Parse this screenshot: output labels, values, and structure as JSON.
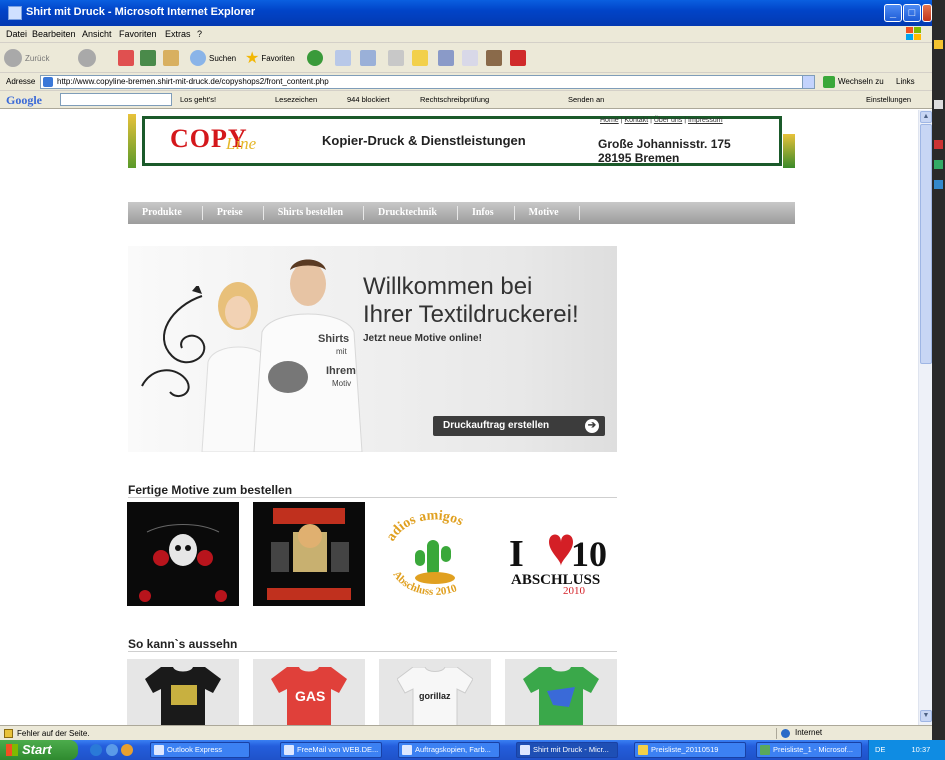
{
  "window": {
    "title": "Shirt mit Druck - Microsoft Internet Explorer",
    "buttons": {
      "minimize": "_",
      "maximize": "□",
      "close": "×"
    }
  },
  "menu": [
    "Datei",
    "Bearbeiten",
    "Ansicht",
    "Favoriten",
    "Extras",
    "?"
  ],
  "toolbar": {
    "back": "Zurück",
    "search": "Suchen",
    "favorites": "Favoriten"
  },
  "address": {
    "label": "Adresse",
    "url": "http://www.copyline-bremen.shirt-mit-druck.de/copyshops2/front_content.php",
    "go": "Wechseln zu",
    "links": "Links"
  },
  "google": {
    "logo": "Google",
    "go_label": "Los geht's!",
    "bookmarks": "Lesezeichen",
    "blocked": "944 blockiert",
    "spell": "Rechtschreibprüfung",
    "send": "Senden an",
    "settings": "Einstellungen"
  },
  "page": {
    "header": {
      "logo_main": "COPY",
      "logo_script": "Line",
      "service": "Kopier-Druck & Dienstleistungen",
      "links": [
        "Home",
        "Kontakt",
        "Über uns",
        "Impressum"
      ],
      "address_line1": "Große Johannisstr. 175",
      "address_line2": "28195 Bremen"
    },
    "nav": [
      "Produkte",
      "Preise",
      "Shirts bestellen",
      "Drucktechnik",
      "Infos",
      "Motive"
    ],
    "hero": {
      "headline1": "Willkommen bei",
      "headline2": "Ihrer Textildruckerei!",
      "subline": "Jetzt neue Motive online!",
      "cta": "Druckauftrag erstellen",
      "hoodie_text": "Shirts mit Ihrem Motiv"
    },
    "motifs_title": "Fertige Motive zum bestellen",
    "motifs": [
      {
        "name": "skull-roses"
      },
      {
        "name": "wir-gaben-alles"
      },
      {
        "name": "adios-amigos",
        "text_top": "adios amigos",
        "text_bottom": "Abschluss 2010"
      },
      {
        "name": "i-love-10",
        "text_top": "I",
        "text_num": "10",
        "text_bottom": "ABSCHLUSS",
        "text_year": "2010"
      }
    ],
    "examples_title": "So kann`s aussehn",
    "examples": [
      {
        "name": "black-shirt",
        "color": "#1a1a1a"
      },
      {
        "name": "red-shirt",
        "color": "#e0403a",
        "text": "GAS"
      },
      {
        "name": "white-shirt",
        "color": "#f2f2f2",
        "text": "gorillaz"
      },
      {
        "name": "green-shirt",
        "color": "#3aa84a"
      }
    ]
  },
  "status": {
    "text": "Fehler auf der Seite.",
    "zone": "Internet"
  },
  "taskbar": {
    "start": "Start",
    "tasks": [
      "Outlook Express",
      "FreeMail von WEB.DE...",
      "Auftragskopien, Farb...",
      "Shirt mit Druck - Micr...",
      "Preisliste_20110519",
      "Preisliste_1 - Microsof..."
    ],
    "lang": "DE",
    "time": "10:37"
  }
}
